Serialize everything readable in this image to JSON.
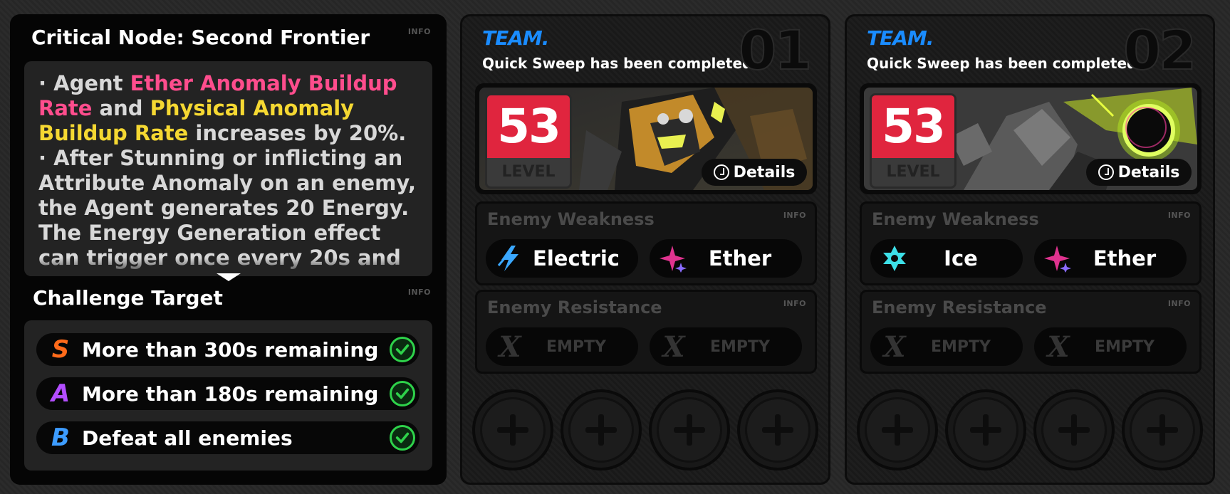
{
  "info_label": "INFO",
  "challenge": {
    "title": "Critical Node: Second Frontier",
    "description": [
      {
        "bullet": "· ",
        "parts": [
          {
            "text": "Agent ",
            "style": "normal"
          },
          {
            "text": "Ether Anomaly Buildup Rate",
            "style": "pink"
          },
          {
            "text": " and ",
            "style": "normal"
          },
          {
            "text": "Physical Anomaly Buildup Rate",
            "style": "yellow"
          },
          {
            "text": " increases by 20%.",
            "style": "normal"
          }
        ]
      },
      {
        "bullet": "· ",
        "parts": [
          {
            "text": "After Stunning or inflicting an Attribute Anomaly on an enemy, the Agent generates 20 Energy. The Energy Generation effect can trigger once every 20s and",
            "style": "normal"
          }
        ]
      }
    ],
    "target_title": "Challenge Target",
    "targets": [
      {
        "grade": "S",
        "color": "#ff6a1a",
        "text": "More than 300s remaining",
        "done": true
      },
      {
        "grade": "A",
        "color": "#b34dff",
        "text": "More than 180s remaining",
        "done": true
      },
      {
        "grade": "B",
        "color": "#3d9cff",
        "text": "Defeat all enemies",
        "done": true
      }
    ]
  },
  "teams": [
    {
      "label": "TEAM.",
      "number": "01",
      "status": "Quick Sweep has been completed",
      "level": "53",
      "level_label": "LEVEL",
      "details_label": "Details",
      "art": "mech-enemy",
      "weakness_title": "Enemy Weakness",
      "weakness": [
        {
          "name": "Electric",
          "icon": "electric-icon"
        },
        {
          "name": "Ether",
          "icon": "ether-icon"
        }
      ],
      "resistance_title": "Enemy Resistance",
      "resistance": [
        {
          "name": "EMPTY",
          "icon": "x-icon"
        },
        {
          "name": "EMPTY",
          "icon": "x-icon"
        }
      ]
    },
    {
      "label": "TEAM.",
      "number": "02",
      "status": "Quick Sweep has been completed",
      "level": "53",
      "level_label": "LEVEL",
      "details_label": "Details",
      "art": "ether-core-enemy",
      "weakness_title": "Enemy Weakness",
      "weakness": [
        {
          "name": "Ice",
          "icon": "ice-icon"
        },
        {
          "name": "Ether",
          "icon": "ether-icon"
        }
      ],
      "resistance_title": "Enemy Resistance",
      "resistance": [
        {
          "name": "EMPTY",
          "icon": "x-icon"
        },
        {
          "name": "EMPTY",
          "icon": "x-icon"
        }
      ]
    }
  ],
  "colors": {
    "team_label": "#1a8cff",
    "level_badge": "#e0253e",
    "check": "#2ed24a",
    "highlight_pink": "#ff4d8d",
    "highlight_yellow": "#f5d832"
  }
}
